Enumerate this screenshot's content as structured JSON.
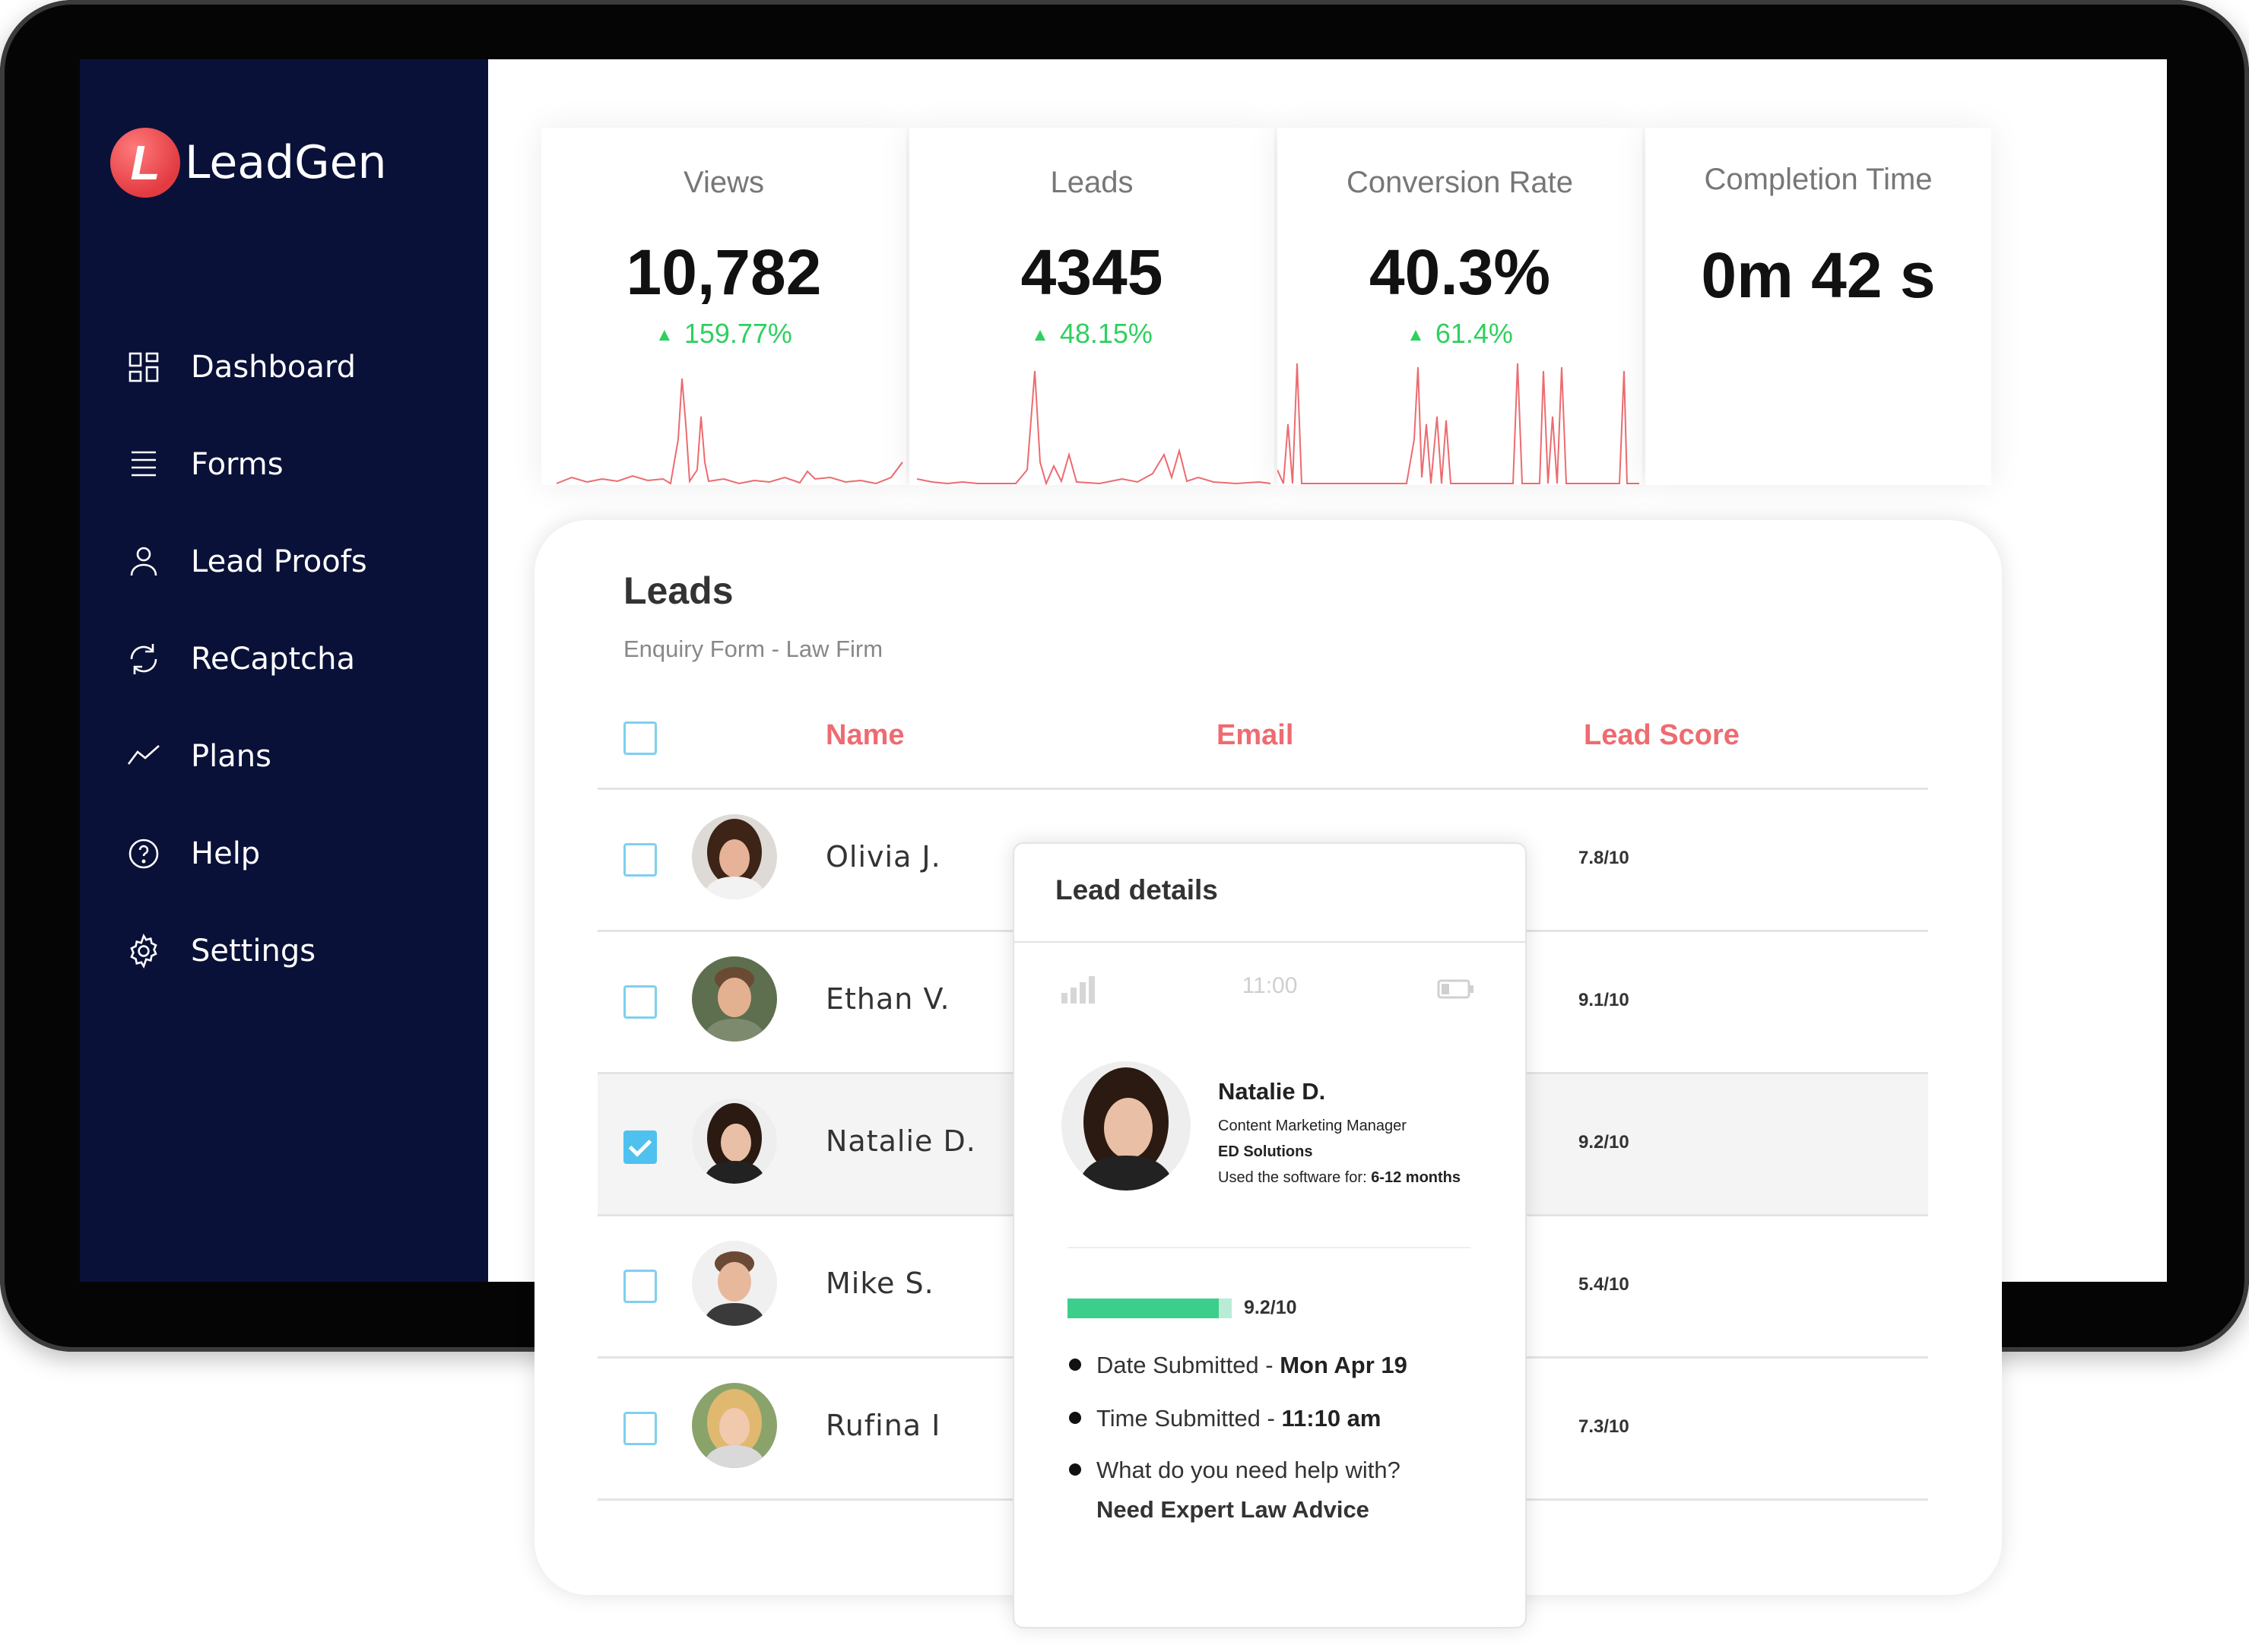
{
  "brand": {
    "logo_letter": "L",
    "name": "LeadGen"
  },
  "nav": [
    {
      "label": "Dashboard",
      "icon": "dashboard-icon"
    },
    {
      "label": "Forms",
      "icon": "forms-icon"
    },
    {
      "label": "Lead Proofs",
      "icon": "user-icon"
    },
    {
      "label": "ReCaptcha",
      "icon": "refresh-icon"
    },
    {
      "label": "Plans",
      "icon": "trend-icon"
    },
    {
      "label": "Help",
      "icon": "help-icon"
    },
    {
      "label": "Settings",
      "icon": "gear-icon"
    }
  ],
  "stats": [
    {
      "title": "Views",
      "value": "10,782",
      "change": "159.77%"
    },
    {
      "title": "Leads",
      "value": "4345",
      "change": "48.15%"
    },
    {
      "title": "Conversion Rate",
      "value": "40.3%",
      "change": "61.4%"
    },
    {
      "title": "Completion Time",
      "value": "0m 42 s",
      "change": ""
    }
  ],
  "leads": {
    "title": "Leads",
    "subtitle": "Enquiry Form - Law Firm",
    "columns": {
      "name": "Name",
      "email": "Email",
      "score": "Lead Score"
    },
    "rows": [
      {
        "name": "Olivia J.",
        "score": "7.8/10",
        "checked": false
      },
      {
        "name": "Ethan V.",
        "score": "9.1/10",
        "checked": false
      },
      {
        "name": "Natalie D.",
        "score": "9.2/10",
        "checked": true
      },
      {
        "name": "Mike S.",
        "score": "5.4/10",
        "checked": false
      },
      {
        "name": "Rufina I",
        "score": "7.3/10",
        "checked": false
      }
    ]
  },
  "details": {
    "title": "Lead details",
    "status_time": "11:00",
    "name": "Natalie D.",
    "role": "Content Marketing Manager",
    "company": "ED Solutions",
    "usage_label": "Used the software for: ",
    "usage_value": "6-12 months",
    "score_label": "9.2/10",
    "score_fraction": 0.92,
    "date_label": "Date Submitted - ",
    "date_value": "Mon Apr 19",
    "time_label": "Time Submitted - ",
    "time_value": "11:10 am",
    "question": "What do you need help with?",
    "answer": "Need Expert Law Advice"
  },
  "colors": {
    "sidebar": "#0a1138",
    "accent": "#ee6b71",
    "positive": "#2fd05f",
    "checkbox": "#4fc1ef"
  }
}
